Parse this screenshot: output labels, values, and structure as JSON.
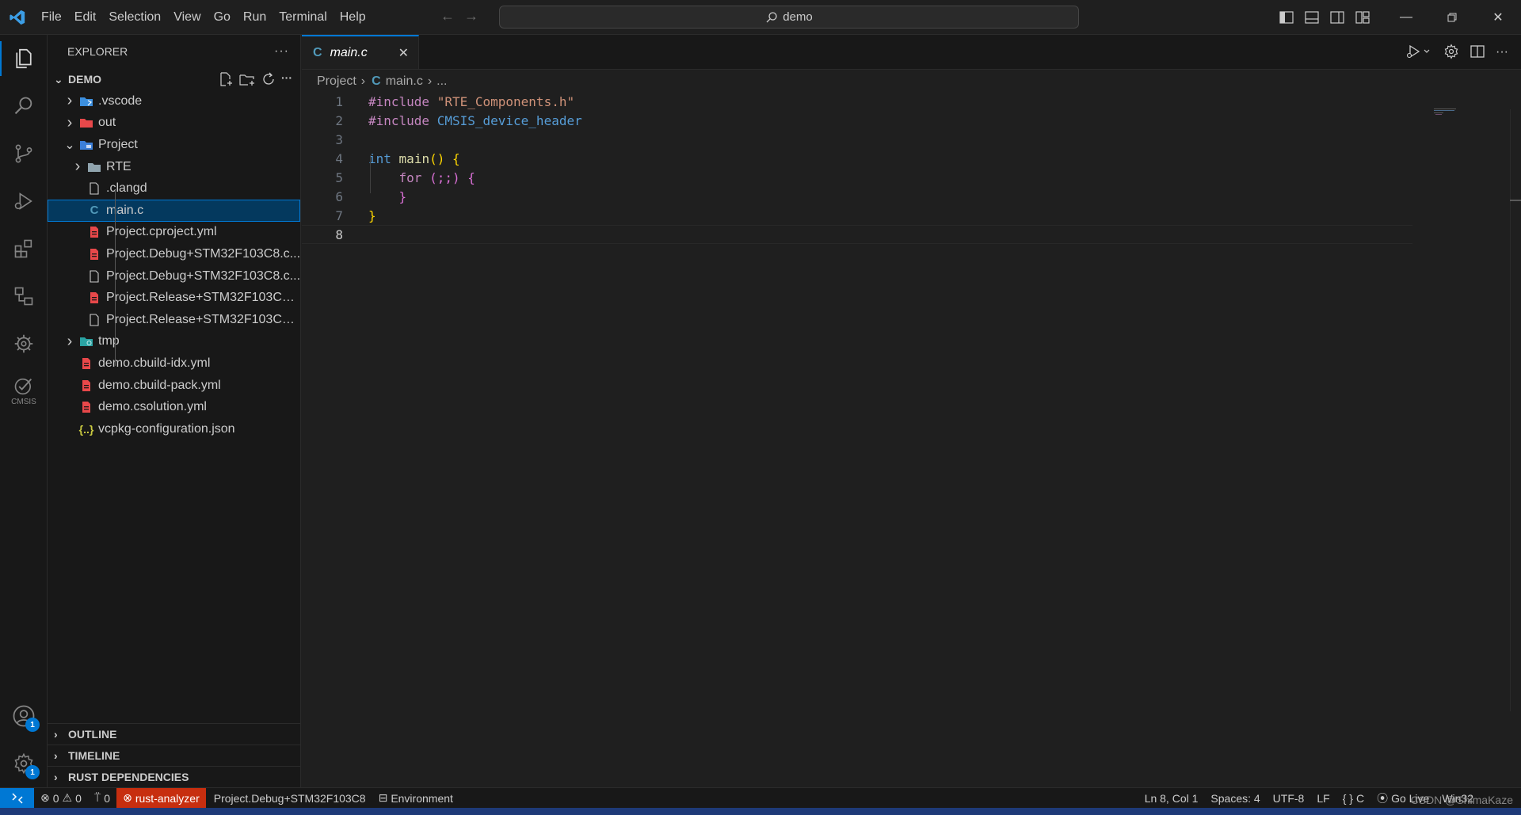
{
  "titlebar": {
    "menu": [
      "File",
      "Edit",
      "Selection",
      "View",
      "Go",
      "Run",
      "Terminal",
      "Help"
    ],
    "search_text": "demo"
  },
  "activitybar": {
    "cmsis_label": "CMSIS",
    "accounts_badge": "1",
    "settings_badge": "1"
  },
  "sidebar": {
    "header": "EXPLORER",
    "root": "DEMO",
    "tree": [
      {
        "label": ".vscode",
        "icon": "folder-vscode-icon",
        "depth": 1,
        "chevron": "right"
      },
      {
        "label": "out",
        "icon": "folder-out-icon",
        "depth": 1,
        "chevron": "right"
      },
      {
        "label": "Project",
        "icon": "folder-project-icon",
        "depth": 1,
        "chevron": "down"
      },
      {
        "label": "RTE",
        "icon": "folder-icon",
        "depth": 2,
        "chevron": "right"
      },
      {
        "label": ".clangd",
        "icon": "file-icon",
        "depth": 2,
        "chevron": ""
      },
      {
        "label": "main.c",
        "icon": "c-file-icon",
        "depth": 2,
        "chevron": "",
        "selected": true
      },
      {
        "label": "Project.cproject.yml",
        "icon": "yaml-file-icon",
        "depth": 2,
        "chevron": ""
      },
      {
        "label": "Project.Debug+STM32F103C8.c...",
        "icon": "yaml-file-icon",
        "depth": 2,
        "chevron": ""
      },
      {
        "label": "Project.Debug+STM32F103C8.c...",
        "icon": "file-icon",
        "depth": 2,
        "chevron": ""
      },
      {
        "label": "Project.Release+STM32F103C8....",
        "icon": "yaml-file-icon",
        "depth": 2,
        "chevron": ""
      },
      {
        "label": "Project.Release+STM32F103C8....",
        "icon": "file-icon",
        "depth": 2,
        "chevron": ""
      },
      {
        "label": "tmp",
        "icon": "folder-tmp-icon",
        "depth": 1,
        "chevron": "right"
      },
      {
        "label": "demo.cbuild-idx.yml",
        "icon": "yaml-file-icon",
        "depth": 1,
        "chevron": ""
      },
      {
        "label": "demo.cbuild-pack.yml",
        "icon": "yaml-file-icon",
        "depth": 1,
        "chevron": ""
      },
      {
        "label": "demo.csolution.yml",
        "icon": "yaml-file-icon",
        "depth": 1,
        "chevron": ""
      },
      {
        "label": "vcpkg-configuration.json",
        "icon": "json-file-icon",
        "depth": 1,
        "chevron": ""
      }
    ],
    "sections": [
      "OUTLINE",
      "TIMELINE",
      "RUST DEPENDENCIES"
    ]
  },
  "editor": {
    "tab": {
      "label": "main.c",
      "icon_letter": "C"
    },
    "breadcrumb": {
      "folder": "Project",
      "file": "main.c",
      "more": "..."
    },
    "lines": [
      "1",
      "2",
      "3",
      "4",
      "5",
      "6",
      "7",
      "8"
    ],
    "code": {
      "l1_directive": "#include",
      "l1_string": "\"RTE_Components.h\"",
      "l2_directive": "#include",
      "l2_macro": "CMSIS_device_header",
      "l4_type": "int",
      "l4_fn": "main",
      "l4_parens": "()",
      "l4_brace": "{",
      "l5_kw": "for",
      "l5_rest": "(;;)",
      "l5_brace": "{",
      "l6_brace": "}",
      "l7_brace": "}"
    }
  },
  "statusbar": {
    "errors": "0",
    "warnings": "0",
    "ports": "0",
    "rust_analyzer": "rust-analyzer",
    "target": "Project.Debug+STM32F103C8",
    "environment": "Environment",
    "position": "Ln 8, Col 1",
    "spaces": "Spaces: 4",
    "encoding": "UTF-8",
    "eol": "LF",
    "language": "C",
    "go_live": "Go Live",
    "platform": "Win32"
  },
  "watermark": "CSDN @ShimaKaze",
  "colors": {
    "accent": "#0078d4",
    "selection": "#04395e",
    "error_bg": "#c72e0f",
    "yaml_icon": "#e8484a",
    "c_icon": "#519aba"
  }
}
